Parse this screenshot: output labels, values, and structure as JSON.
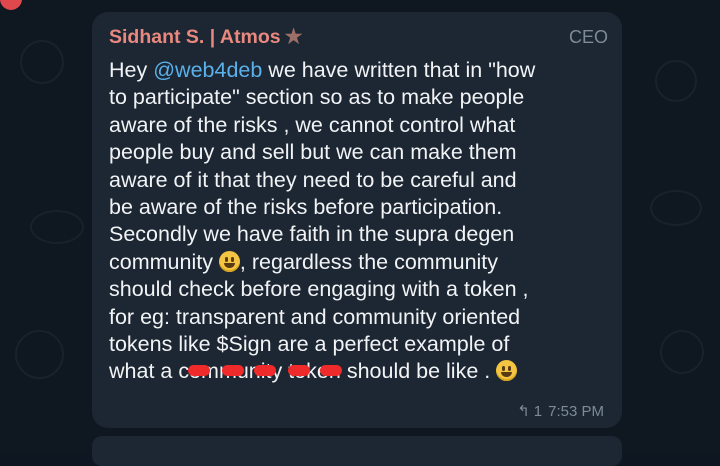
{
  "message": {
    "sender_name": "Sidhant S. | Atmos",
    "sender_badge_icon": "star-icon",
    "sender_color": "#e8887e",
    "role_label": "CEO",
    "mention": "@web4deb",
    "lines": {
      "l1_before": "Hey ",
      "l1_after": " we have written that in \"how",
      "l2": "to participate\" section so as to make people",
      "l3": "aware of the risks , we cannot control what",
      "l4": "people buy and sell but we can make them",
      "l5": "aware of it that they need to be careful and",
      "l6": "be aware of the risks before participation.",
      "l7": "Secondly we have faith in the supra degen",
      "l8_before": "community ",
      "l8_after": ", regardless the community",
      "l9": "should check before engaging with a token ,",
      "l10": "for eg: transparent and community oriented",
      "l11": "tokens like $Sign are a perfect example of",
      "l12_before": "what a ",
      "l12_redacted": "community token",
      "l12_after": " should be like .",
      "emoji_icon": "grinning-face-emoji"
    },
    "reply_count": "1",
    "time": "7:53 PM"
  },
  "colors": {
    "bubble": "#1d2733",
    "background": "#0f1720",
    "mention": "#5ab0ea",
    "redaction": "#ee2a2a"
  }
}
